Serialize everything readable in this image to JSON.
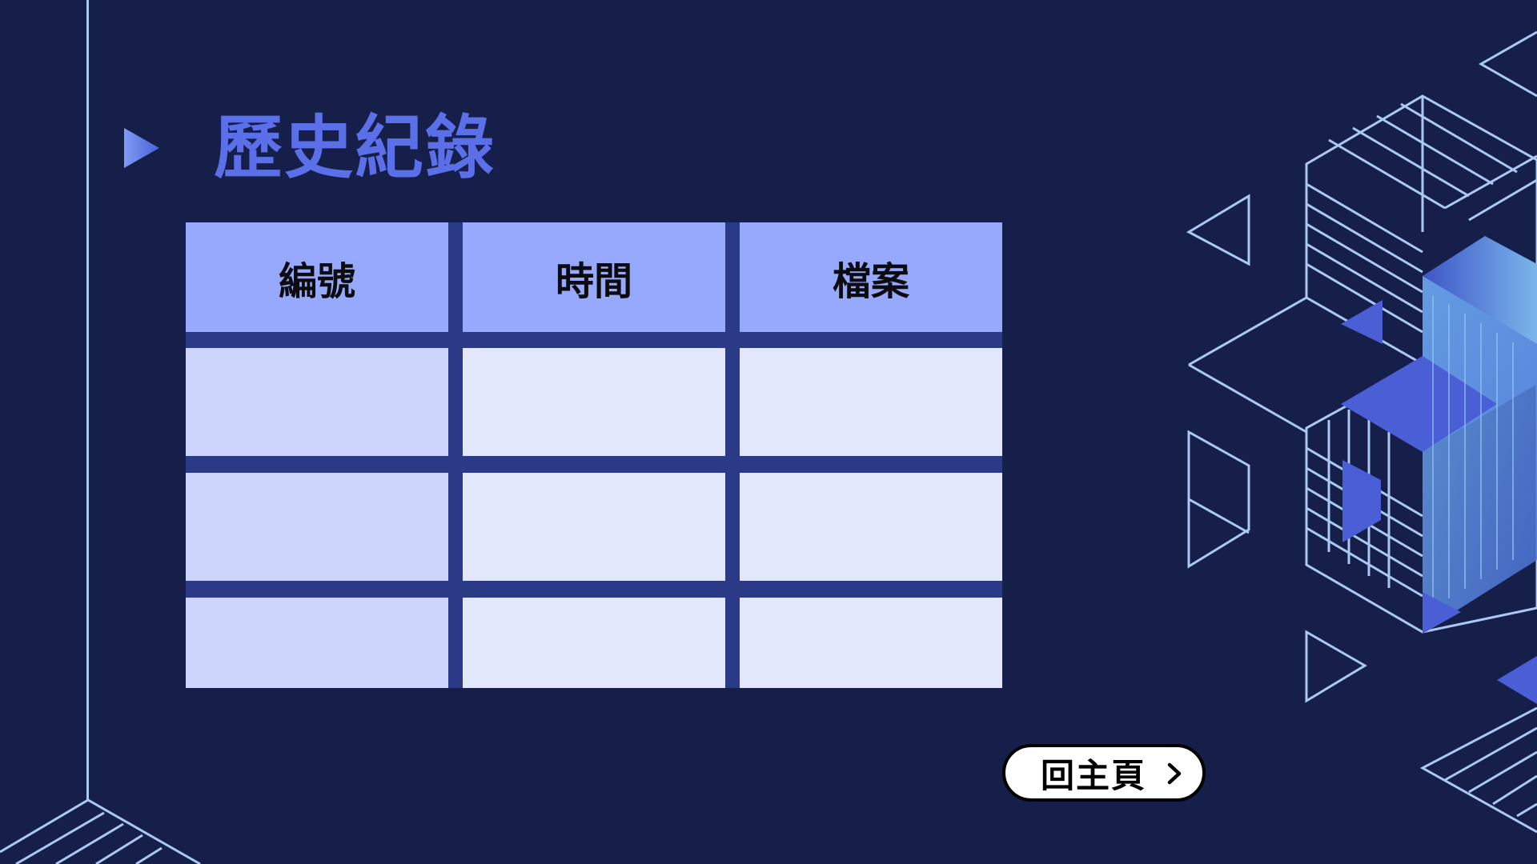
{
  "title": "歷史紀錄",
  "table": {
    "headers": [
      "編號",
      "時間",
      "檔案"
    ],
    "rows": [
      [
        "",
        "",
        ""
      ],
      [
        "",
        "",
        ""
      ],
      [
        "",
        "",
        ""
      ]
    ]
  },
  "home_button": {
    "label": "回主頁"
  },
  "icons": {
    "title_marker": "triangle-play-icon",
    "home_chevron": "chevron-right-icon"
  },
  "colors": {
    "background": "#161f4a",
    "title": "#5b6fe8",
    "header_cell": "#97a9fc",
    "body_cell_first_column": "#cdd5fc",
    "body_cell": "#e3e7fc",
    "table_grid": "#2b3a86",
    "line_accent": "#a9c9f3"
  }
}
